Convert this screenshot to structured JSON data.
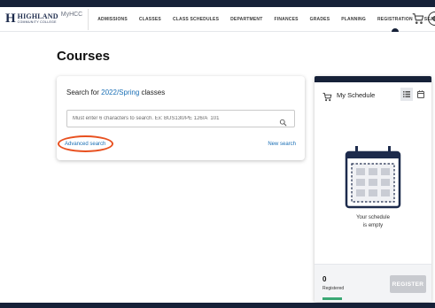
{
  "logo": {
    "name": "HIGHLAND",
    "sub": "COMMUNITY COLLEGE",
    "app": "MyHCC"
  },
  "nav": {
    "items": [
      "ADMISSIONS",
      "CLASSES",
      "CLASS SCHEDULES",
      "DEPARTMENT",
      "FINANCES",
      "GRADES",
      "PLANNING",
      "REGISTRATION",
      "SEARCH"
    ],
    "active": "REGISTRATION",
    "avatar_letter": "C"
  },
  "page": {
    "title": "Courses"
  },
  "search": {
    "heading_prefix": "Search for",
    "term": "2022/Spring",
    "heading_suffix": "classes",
    "placeholder": "Must enter 6 characters to search. Ex: BUS130/PE 126/A  101",
    "advanced_label": "Advanced search",
    "new_search_label": "New search"
  },
  "schedule": {
    "title": "My Schedule",
    "empty_line1": "Your schedule",
    "empty_line2": "is empty",
    "registered_count": "0",
    "registered_label": "Registered",
    "register_label": "REGISTER"
  },
  "colors": {
    "navy": "#162138",
    "link": "#1a6fb5",
    "highlight": "#e8501f",
    "success": "#3aa874"
  }
}
